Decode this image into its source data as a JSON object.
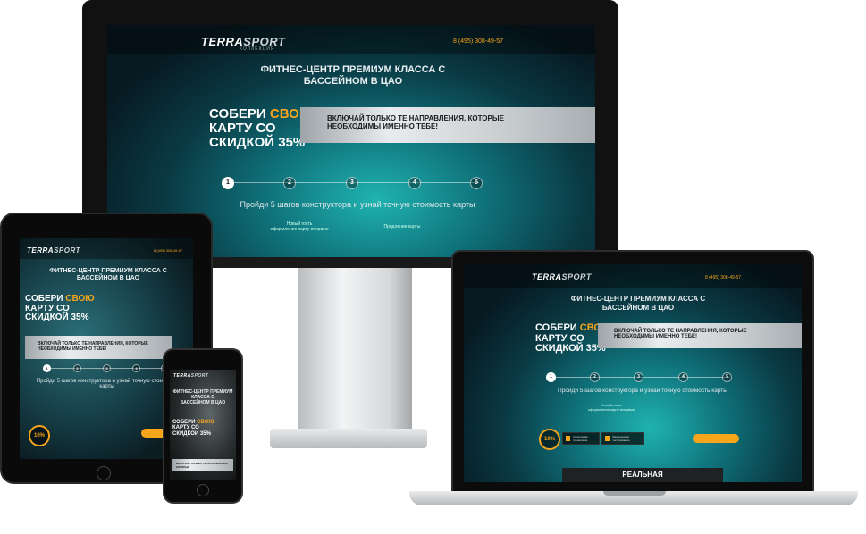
{
  "site": {
    "logo_main": "TERRA",
    "logo_accent": "SPORT",
    "logo_sub": "КОЛЛЕКЦИЯ",
    "phone": "8 (495) 308-49-57",
    "hero_title_line1": "ФИТНЕС-ЦЕНТР ПРЕМИУМ КЛАССА С",
    "hero_title_line2": "БАССЕЙНОМ В ЦАО",
    "collect_line1": "СОБЕРИ",
    "collect_highlight": "СВОЮ",
    "collect_line2": "КАРТУ СО",
    "collect_line3": "СКИДКОЙ 35%",
    "banner_line1": "ВКЛЮЧАЙ ТОЛЬКО ТЕ НАПРАВЛЕНИЯ, КОТОРЫЕ",
    "banner_line2": "НЕОБХОДИМЫ ИМЕННО ТЕБЕ!",
    "steps": [
      "1",
      "2",
      "3",
      "4",
      "5"
    ],
    "steps_text": "Пройди 5 шагов конструктора и узнай точную стоимость карты",
    "label_left": "Новый гость",
    "label_left2": "оформление карту впервые",
    "label_right": "Продление карты",
    "discount": "10%",
    "chip1": "Спортивная тренировка",
    "chip2": "Медицинское тестирование",
    "section_title": "РЕАЛЬНАЯ"
  },
  "colors": {
    "accent": "#f7a51b",
    "banner": "#d9dde0",
    "pool": "#1fb3b0"
  }
}
